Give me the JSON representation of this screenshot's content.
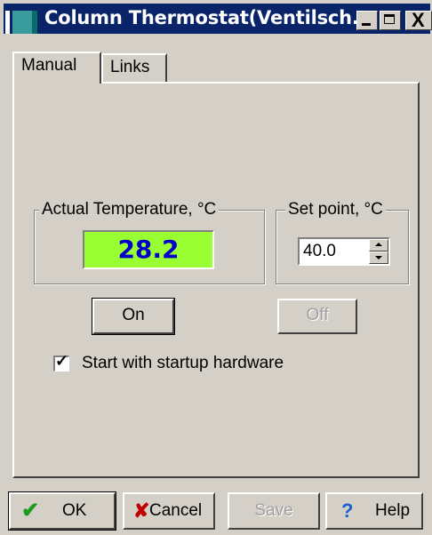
{
  "window": {
    "title": "Column Thermostat(Ventilsch...",
    "minimize_icon": "minimize-icon",
    "maximize_icon": "maximize-icon",
    "close_glyph": "X"
  },
  "tabs": [
    {
      "label": "Manual",
      "active": true
    },
    {
      "label": "Links",
      "active": false
    }
  ],
  "temperature": {
    "legend": "Actual Temperature, °C",
    "value": "28.2",
    "display_bg": "#99ff33",
    "display_fg": "#0000cc"
  },
  "setpoint": {
    "legend": "Set point, °C",
    "value": "40.0"
  },
  "controls": {
    "on_label": "On",
    "off_label": "Off"
  },
  "startup": {
    "label": "Start with startup hardware",
    "checked": true
  },
  "footer": {
    "ok_label": "OK",
    "ok_icon": "checkmark-icon",
    "cancel_label": "Cancel",
    "cancel_icon": "cross-icon",
    "save_label": "Save",
    "help_label": "Help",
    "help_icon": "question-icon"
  },
  "colors": {
    "title_bar": "#0a246a",
    "face": "#d4d0c8"
  }
}
